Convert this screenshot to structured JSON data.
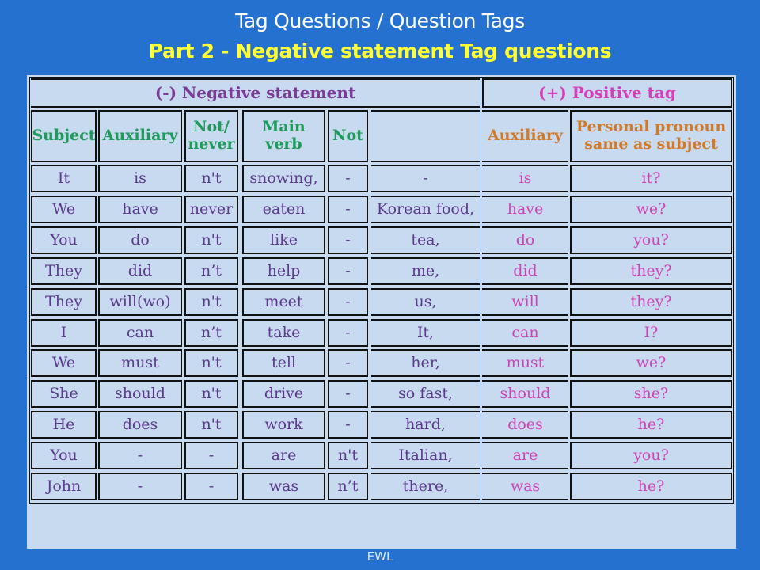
{
  "title": "Tag Questions / Question Tags",
  "subtitle": "Part 2 - Negative statement Tag questions",
  "footer": "EWL",
  "table": {
    "group_headers": {
      "negative": "(-) Negative statement",
      "positive": "(+) Positive tag"
    },
    "columns": {
      "subject": "Subject",
      "auxiliary": "Auxiliary",
      "not_never": "Not/ never",
      "main_verb": "Main verb",
      "not": "Not",
      "object": "",
      "tag_auxiliary": "Auxiliary",
      "pronoun": "Personal pronoun same as subject"
    },
    "rows": [
      {
        "subject": "It",
        "auxiliary": "is",
        "not_never": "n't",
        "main_verb": "snowing,",
        "not": "-",
        "object": "-",
        "tag_auxiliary": "is",
        "pronoun": "it?"
      },
      {
        "subject": "We",
        "auxiliary": "have",
        "not_never": "never",
        "main_verb": "eaten",
        "not": "-",
        "object": "Korean food,",
        "tag_auxiliary": "have",
        "pronoun": "we?"
      },
      {
        "subject": "You",
        "auxiliary": "do",
        "not_never": "n't",
        "main_verb": "like",
        "not": "-",
        "object": "tea,",
        "tag_auxiliary": "do",
        "pronoun": "you?"
      },
      {
        "subject": "They",
        "auxiliary": "did",
        "not_never": "n’t",
        "main_verb": "help",
        "not": "-",
        "object": "me,",
        "tag_auxiliary": "did",
        "pronoun": "they?"
      },
      {
        "subject": "They",
        "auxiliary": "will(wo)",
        "not_never": "n't",
        "main_verb": "meet",
        "not": "-",
        "object": "us,",
        "tag_auxiliary": "will",
        "pronoun": "they?"
      },
      {
        "subject": "I",
        "auxiliary": "can",
        "not_never": "n’t",
        "main_verb": "take",
        "not": "-",
        "object": "It,",
        "tag_auxiliary": "can",
        "pronoun": "I?"
      },
      {
        "subject": "We",
        "auxiliary": "must",
        "not_never": "n't",
        "main_verb": "tell",
        "not": "-",
        "object": "her,",
        "tag_auxiliary": "must",
        "pronoun": "we?"
      },
      {
        "subject": "She",
        "auxiliary": "should",
        "not_never": "n't",
        "main_verb": "drive",
        "not": "-",
        "object": "so fast,",
        "tag_auxiliary": "should",
        "pronoun": "she?"
      },
      {
        "subject": "He",
        "auxiliary": "does",
        "not_never": "n't",
        "main_verb": "work",
        "not": "-",
        "object": "hard,",
        "tag_auxiliary": "does",
        "pronoun": "he?"
      },
      {
        "subject": "You",
        "auxiliary": "-",
        "not_never": "-",
        "main_verb": "are",
        "not": "n't",
        "object": "Italian,",
        "tag_auxiliary": "are",
        "pronoun": "you?"
      },
      {
        "subject": "John",
        "auxiliary": "-",
        "not_never": "-",
        "main_verb": "was",
        "not": "n’t",
        "object": "there,",
        "tag_auxiliary": "was",
        "pronoun": "he?"
      }
    ]
  }
}
